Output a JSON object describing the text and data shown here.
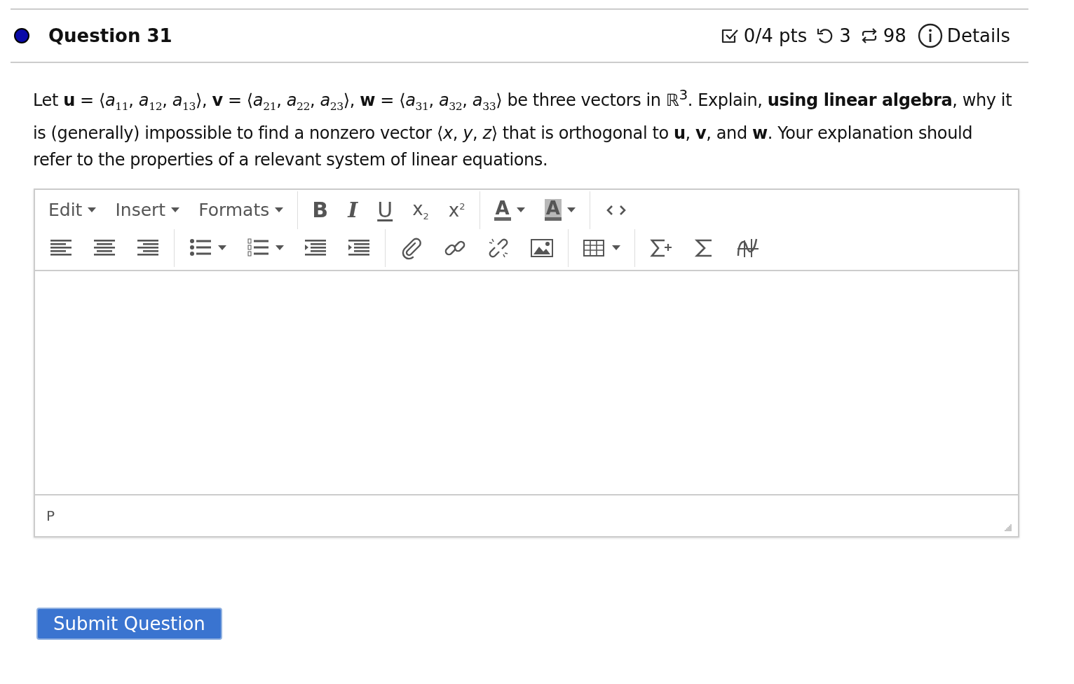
{
  "question": {
    "answered": false,
    "title": "Question 31",
    "score": "0/4 pts",
    "attempts": "3",
    "submissions": "98",
    "details": "Details"
  },
  "prompt": "Let **u** = ⟨*a*$_{11}$, *a*$_{12}$, *a*$_{13}$⟩, **v** = ⟨*a*$_{21}$, *a*$_{22}$, *a*$_{23}$⟩, **w** = ⟨*a*$_{31}$, *a*$_{32}$, *a*$_{33}$⟩ be three vectors in ℝ$^{3}$. Explain, **using linear algebra**, why it is (generally) impossible to find a nonzero vector ⟨*x*, *y*, *z*⟩ that is orthogonal to **u**, **v**, and **w**. Your explanation should refer to the properties of a relevant system of linear equations.",
  "editor": {
    "toolbar_rows": [
      [
        [
          {
            "kind": "menu",
            "label": "Edit"
          },
          {
            "kind": "menu",
            "label": "Insert"
          },
          {
            "kind": "menu",
            "label": "Formats"
          }
        ],
        [
          {
            "kind": "bold",
            "label": "B"
          },
          {
            "kind": "italic",
            "label": "I"
          },
          {
            "kind": "underline",
            "label": "U"
          },
          {
            "kind": "subscript",
            "label": "x$_{2}$"
          },
          {
            "kind": "superscript",
            "label": "x$^{2}$"
          }
        ],
        [
          {
            "kind": "text-color",
            "label": "A"
          },
          {
            "kind": "background-color",
            "label": "A"
          }
        ],
        [
          {
            "kind": "code"
          }
        ]
      ],
      [
        [
          {
            "kind": "align-left"
          },
          {
            "kind": "align-center"
          },
          {
            "kind": "align-right"
          }
        ],
        [
          {
            "kind": "bullet-list"
          },
          {
            "kind": "numbered-list"
          },
          {
            "kind": "outdent"
          },
          {
            "kind": "indent"
          }
        ],
        [
          {
            "kind": "attach"
          },
          {
            "kind": "link"
          },
          {
            "kind": "unlink"
          },
          {
            "kind": "image"
          }
        ],
        [
          {
            "kind": "table"
          }
        ],
        [
          {
            "kind": "sum-plus"
          },
          {
            "kind": "sum"
          },
          {
            "kind": "graph"
          }
        ]
      ]
    ],
    "path": "P"
  },
  "submit": "Submit Question"
}
